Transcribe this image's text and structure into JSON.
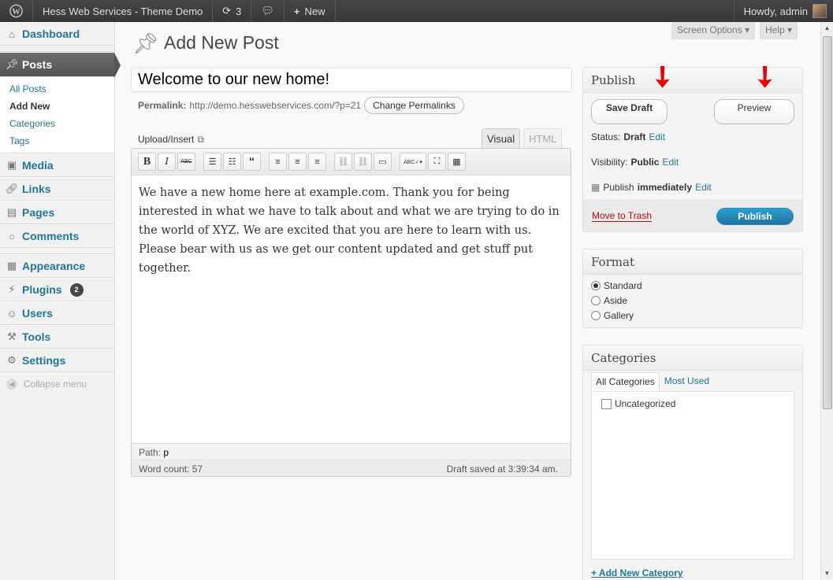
{
  "adminbar": {
    "site_name": "Hess Web Services - Theme Demo",
    "updates_count": "3",
    "new_label": "New",
    "howdy": "Howdy, admin"
  },
  "sidebar": {
    "dashboard": "Dashboard",
    "posts": "Posts",
    "posts_sub": [
      "All Posts",
      "Add New",
      "Categories",
      "Tags"
    ],
    "media": "Media",
    "links": "Links",
    "pages": "Pages",
    "comments": "Comments",
    "appearance": "Appearance",
    "plugins": "Plugins",
    "plugins_badge": "2",
    "users": "Users",
    "tools": "Tools",
    "settings": "Settings",
    "collapse": "Collapse menu"
  },
  "screen_options": {
    "screen": "Screen Options",
    "help": "Help"
  },
  "page": {
    "title": "Add New Post"
  },
  "post": {
    "title": "Welcome to our new home!",
    "permalink_label": "Permalink:",
    "permalink_url": "http://demo.hesswebservices.com/?p=21",
    "change_permalinks": "Change Permalinks",
    "upload_insert": "Upload/Insert",
    "tab_visual": "Visual",
    "tab_html": "HTML",
    "content": "We have a new home here at example.com. Thank you for being interested in what we have to talk about and what we are trying to do in the world of XYZ. We are excited that you are here to learn with us. Please bear with us as we get our content updated and get stuff put together.",
    "path_label": "Path:",
    "path_value": "p",
    "word_count": "Word count: 57",
    "draft_saved": "Draft saved at 3:39:34 am."
  },
  "publish": {
    "heading": "Publish",
    "save_draft": "Save Draft",
    "preview": "Preview",
    "status_label": "Status:",
    "status_value": "Draft",
    "visibility_label": "Visibility:",
    "visibility_value": "Public",
    "publish_label": "Publish",
    "publish_value": "immediately",
    "edit": "Edit",
    "trash": "Move to Trash",
    "publish_button": "Publish"
  },
  "format": {
    "heading": "Format",
    "options": [
      "Standard",
      "Aside",
      "Gallery"
    ],
    "selected": "Standard"
  },
  "categories": {
    "heading": "Categories",
    "tab_all": "All Categories",
    "tab_used": "Most Used",
    "items": [
      "Uncategorized"
    ],
    "add_new": "+ Add New Category"
  }
}
